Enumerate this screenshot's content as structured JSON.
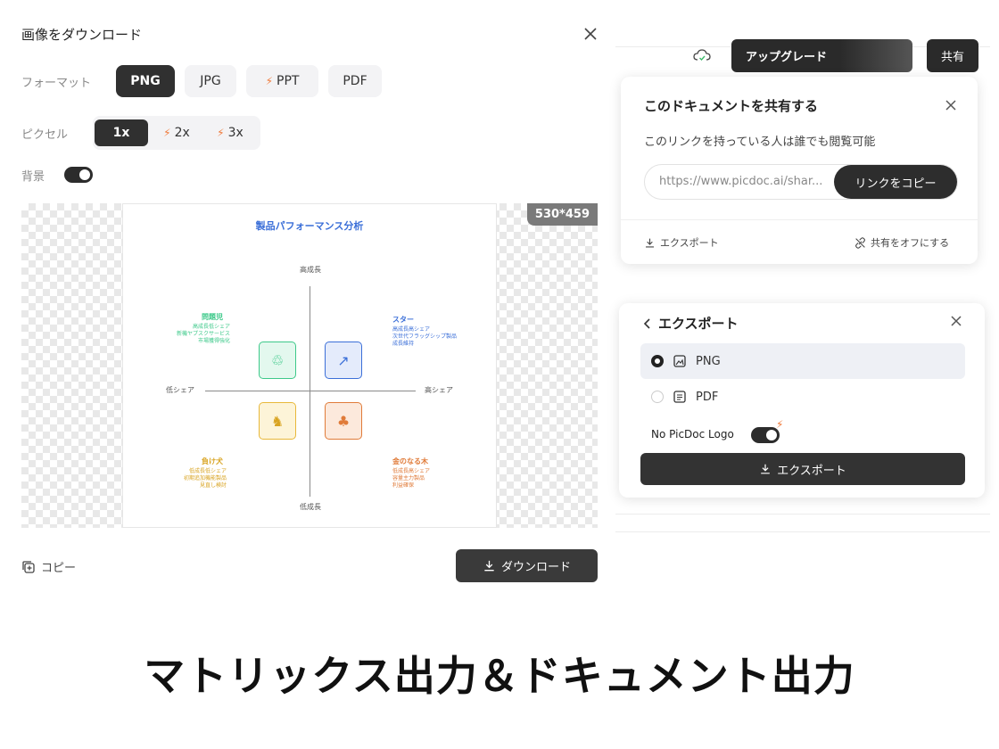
{
  "dialog": {
    "title": "画像をダウンロード",
    "format_label": "フォーマット",
    "formats": [
      "PNG",
      "JPG",
      "PPT",
      "PDF"
    ],
    "pixel_label": "ピクセル",
    "pixels": [
      "1x",
      "2x",
      "3x"
    ],
    "background_label": "背景",
    "size_badge": "530*459",
    "copy_label": "コピー",
    "download_label": "ダウンロード"
  },
  "matrix": {
    "title": "製品パフォーマンス分析",
    "axis_top": "高成長",
    "axis_bottom": "低成長",
    "axis_left": "低シェア",
    "axis_right": "高シェア",
    "q_problem": {
      "title": "問題児",
      "lines": [
        "高成長低シェア",
        "新機ヤプスクサービス",
        "市場獲得強化"
      ]
    },
    "q_star": {
      "title": "スター",
      "lines": [
        "高成長高シェア",
        "次世代フラッグシップ製品",
        "成長維持"
      ]
    },
    "q_dog": {
      "title": "負け犬",
      "lines": [
        "低成長低シェア",
        "初期追加機能製品",
        "見直し検討"
      ]
    },
    "q_cow": {
      "title": "金のなる木",
      "lines": [
        "低成長高シェア",
        "容量主力製品",
        "利益確保"
      ]
    }
  },
  "topbar": {
    "upgrade_label": "アップグレード",
    "share_label": "共有"
  },
  "share": {
    "title": "このドキュメントを共有する",
    "description": "このリンクを持っている人は誰でも閲覧可能",
    "link": "https://www.picdoc.ai/shar...",
    "copy_link_label": "リンクをコピー",
    "export_label": "エクスポート",
    "share_off_label": "共有をオフにする"
  },
  "export": {
    "title": "エクスポート",
    "options": [
      "PNG",
      "PDF"
    ],
    "nologo_label": "No PicDoc Logo",
    "button_label": "エクスポート"
  },
  "headline": "マトリックス出力＆ドキュメント出力",
  "colors": {
    "dark": "#2c2c2c",
    "matrix_title": "#3b6fd8",
    "problem": "#3dc98a",
    "star": "#3b6fd8",
    "dog": "#e8b83a",
    "cow": "#e07b39",
    "premium_bolt": "#f07a3a"
  }
}
